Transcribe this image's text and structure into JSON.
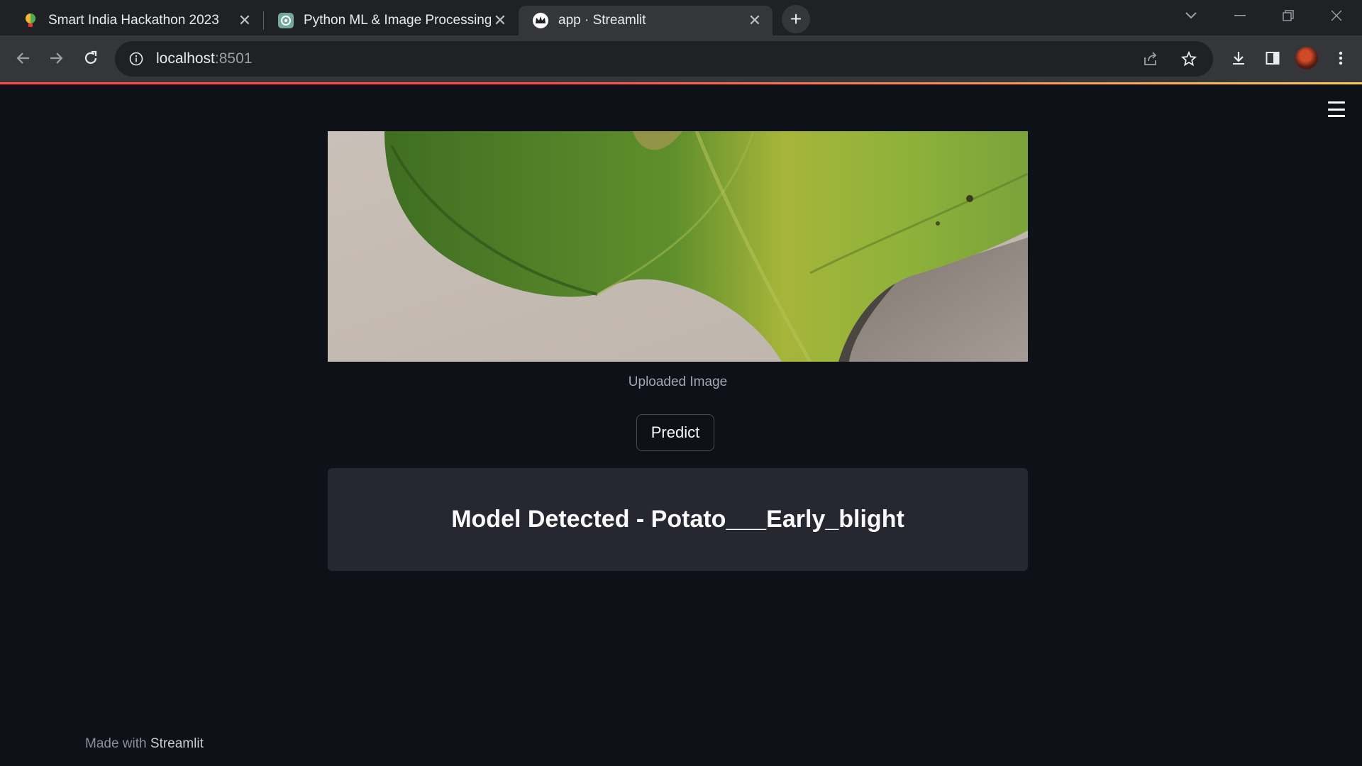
{
  "browser": {
    "tabs": [
      {
        "title": "Smart India Hackathon 2023",
        "favicon": "hackathon-bulb-icon"
      },
      {
        "title": "Python ML & Image Processing",
        "favicon": "chatgpt-icon"
      },
      {
        "title": "app · Streamlit",
        "favicon": "streamlit-crown-icon",
        "active": true
      }
    ],
    "url_host": "localhost",
    "url_port": ":8501"
  },
  "app": {
    "image_caption": "Uploaded Image",
    "predict_label": "Predict",
    "result_text": "Model Detected - Potato___Early_blight",
    "footer_prefix": "Made with",
    "footer_brand": "Streamlit"
  },
  "colors": {
    "app_background": "#0e1117",
    "result_background": "#262730",
    "accent": "#ff4b4b"
  }
}
